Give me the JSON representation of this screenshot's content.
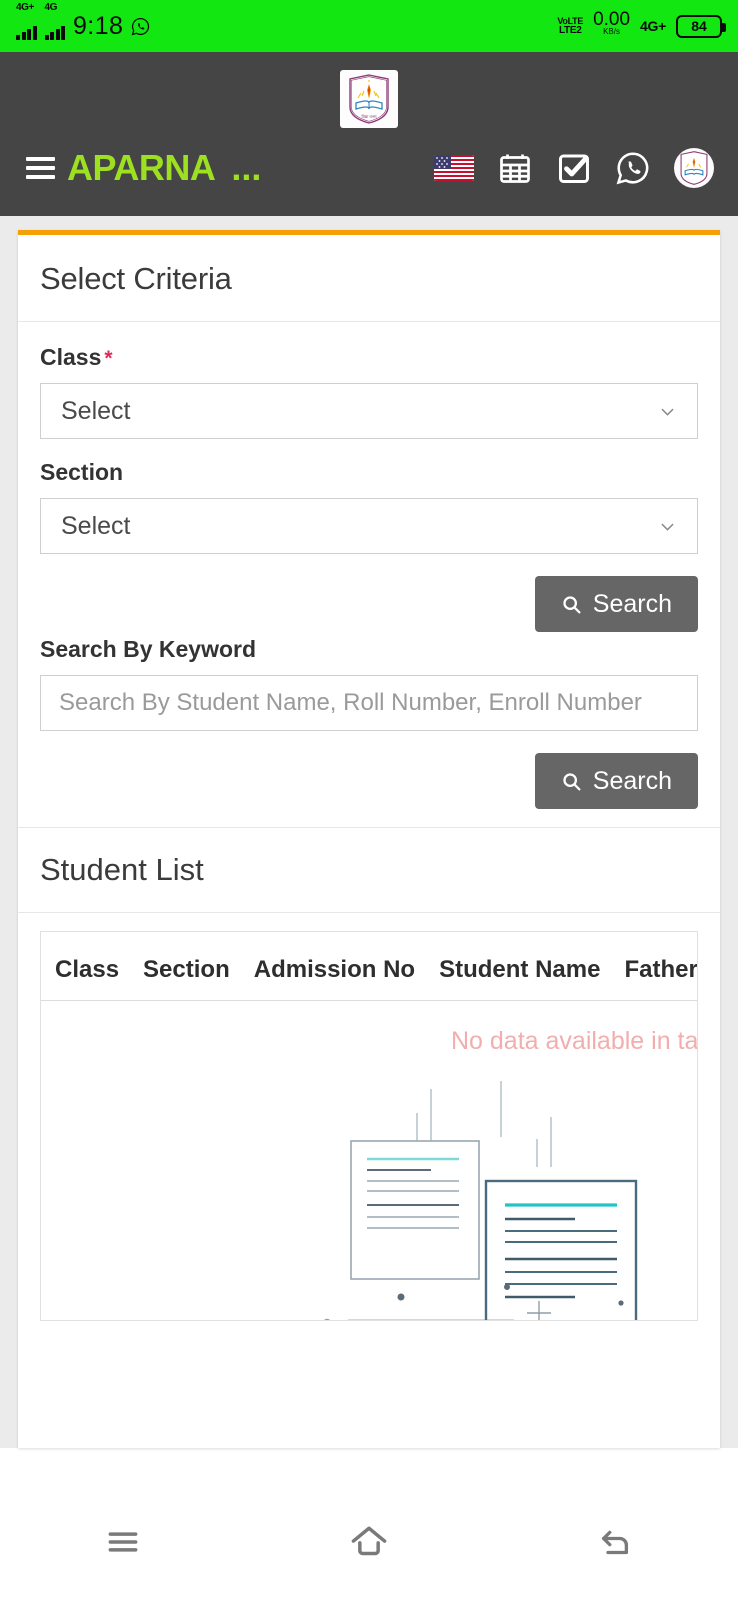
{
  "status_bar": {
    "network_primary": "4G+",
    "network_secondary": "4G",
    "time": "9:18",
    "whatsapp_icon": "whatsapp-icon",
    "volte_line1": "VoLTE",
    "volte_line2": "LTE2",
    "data_rate": "0.00",
    "data_unit": "KB/s",
    "network_right": "4G+",
    "battery_level": "84"
  },
  "header": {
    "logo_icon": "school-crest-logo",
    "menu_icon": "hamburger-menu-icon",
    "brand": "APARNA",
    "brand_ellipsis": "...",
    "icons": [
      {
        "name": "language-flag-icon",
        "label": "US"
      },
      {
        "name": "calendar-icon",
        "label": "Calendar"
      },
      {
        "name": "task-check-icon",
        "label": "Tasks"
      },
      {
        "name": "whatsapp-icon",
        "label": "WhatsApp"
      },
      {
        "name": "profile-avatar-icon",
        "label": "Profile"
      }
    ]
  },
  "criteria": {
    "title": "Select Criteria",
    "class_label": "Class",
    "required_marker": "*",
    "class_value": "Select",
    "section_label": "Section",
    "section_value": "Select",
    "search_button": "Search",
    "keyword_label": "Search By Keyword",
    "keyword_value": "",
    "keyword_placeholder": "Search By Student Name, Roll Number, Enroll Number",
    "keyword_search_button": "Search"
  },
  "student_list": {
    "title": "Student List",
    "columns": [
      "Class",
      "Section",
      "Admission No",
      "Student Name",
      "Father Name"
    ],
    "empty_message": "No data available in table",
    "rows": []
  },
  "bottom_nav": {
    "recents_icon": "recents-icon",
    "home_icon": "home-icon",
    "back_icon": "back-icon"
  },
  "colors": {
    "status_bar": "#12E712",
    "header_bg": "#454545",
    "brand": "#9CE021",
    "accent_top": "#F5A106",
    "button": "#666666",
    "required": "#e02a5a",
    "empty_text": "#f2aeae"
  }
}
